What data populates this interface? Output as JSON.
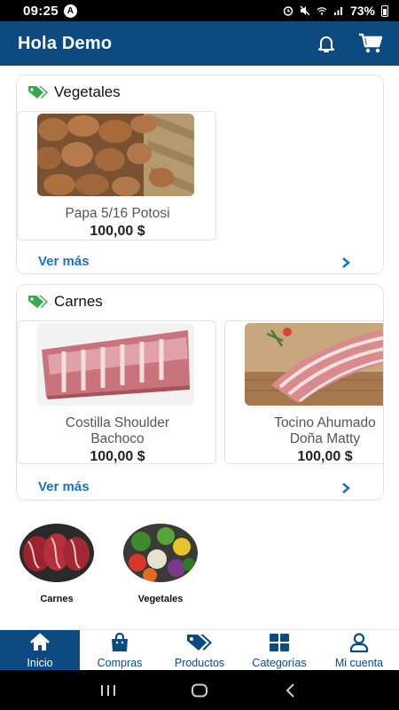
{
  "status_bar": {
    "time": "09:25",
    "battery": "73%"
  },
  "header": {
    "title": "Hola Demo"
  },
  "sections": [
    {
      "title": "Vegetales",
      "more_label": "Ver más",
      "products": [
        {
          "name": "Papa 5/16 Potosi",
          "price": "100,00 $"
        }
      ]
    },
    {
      "title": "Carnes",
      "more_label": "Ver más",
      "products": [
        {
          "name_line1": "Costilla Shoulder",
          "name_line2": "Bachoco",
          "price": "100,00 $"
        },
        {
          "name_line1": "Tocino Ahumado",
          "name_line2": "Doña Matty",
          "price": "100,00 $"
        }
      ]
    }
  ],
  "categories": [
    {
      "label": "Carnes"
    },
    {
      "label": "Vegetales"
    }
  ],
  "bottom_nav": [
    {
      "label": "Inicio",
      "icon": "home-icon",
      "active": true
    },
    {
      "label": "Compras",
      "icon": "bag-icon"
    },
    {
      "label": "Productos",
      "icon": "tags-icon"
    },
    {
      "label": "Categorías",
      "icon": "grid-icon"
    },
    {
      "label": "Mi cuenta",
      "icon": "user-icon"
    }
  ],
  "colors": {
    "primary": "#0d4a7f",
    "link": "#1c73b4",
    "tag": "#3aa84a"
  }
}
